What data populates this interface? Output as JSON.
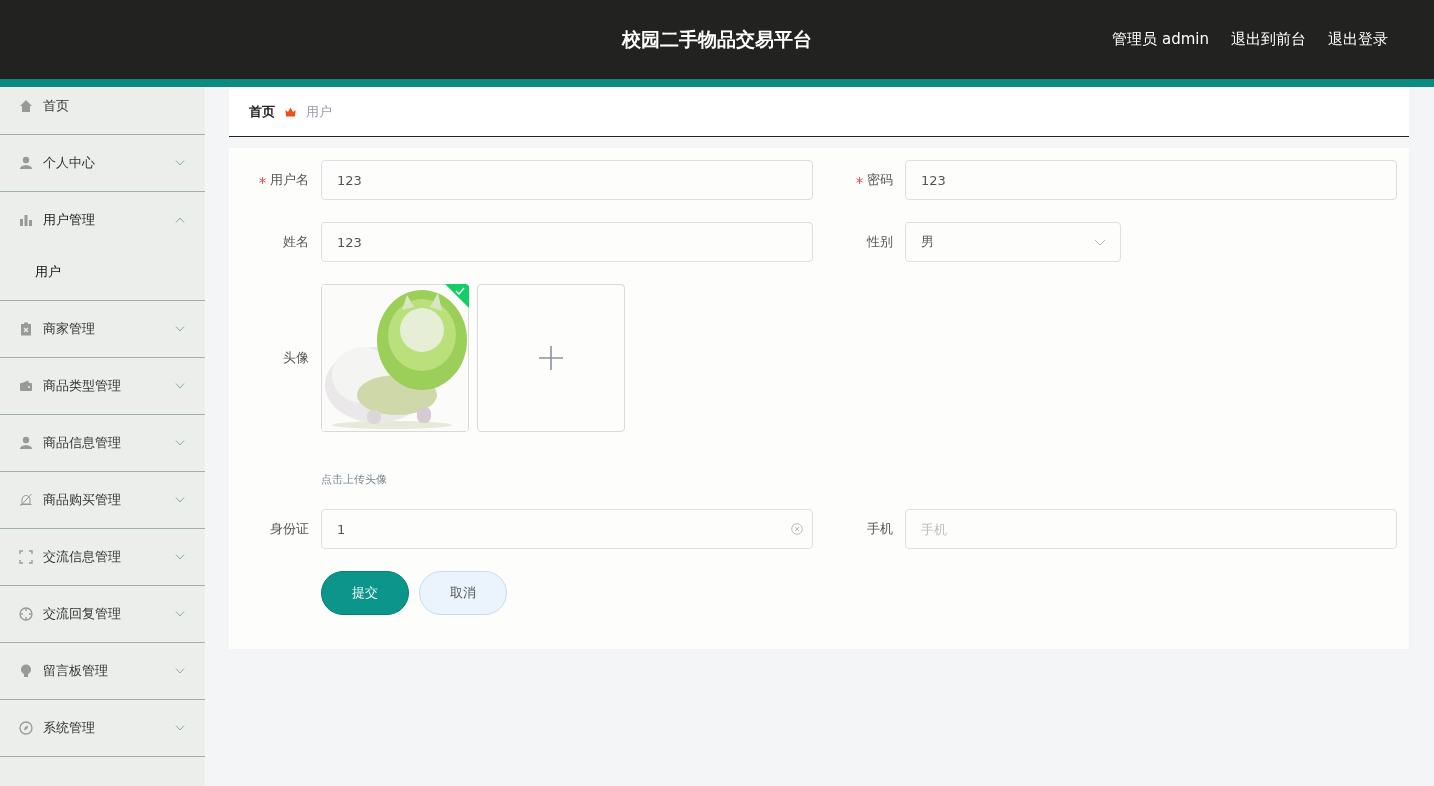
{
  "header": {
    "title": "校园二手物品交易平台",
    "user": "管理员 admin",
    "links": [
      "退出到前台",
      "退出登录"
    ]
  },
  "sidebar": {
    "items": [
      {
        "label": "首页",
        "kind": "link"
      },
      {
        "label": "个人中心",
        "kind": "menu",
        "expanded": false
      },
      {
        "label": "用户管理",
        "kind": "menu",
        "expanded": true,
        "children": [
          {
            "label": "用户"
          }
        ]
      },
      {
        "label": "商家管理",
        "kind": "menu",
        "expanded": false
      },
      {
        "label": "商品类型管理",
        "kind": "menu",
        "expanded": false
      },
      {
        "label": "商品信息管理",
        "kind": "menu",
        "expanded": false
      },
      {
        "label": "商品购买管理",
        "kind": "menu",
        "expanded": false
      },
      {
        "label": "交流信息管理",
        "kind": "menu",
        "expanded": false
      },
      {
        "label": "交流回复管理",
        "kind": "menu",
        "expanded": false
      },
      {
        "label": "留言板管理",
        "kind": "menu",
        "expanded": false
      },
      {
        "label": "系统管理",
        "kind": "menu",
        "expanded": false
      }
    ]
  },
  "breadcrumb": [
    "首页",
    "用户"
  ],
  "form": {
    "fields": [
      {
        "kind": "text",
        "label": "用户名",
        "required": true,
        "value": "123"
      },
      {
        "kind": "text",
        "label": "密码",
        "required": true,
        "value": "123"
      },
      {
        "kind": "text",
        "label": "姓名",
        "required": false,
        "value": "123"
      },
      {
        "kind": "select",
        "label": "性别",
        "required": false,
        "value": "男"
      },
      {
        "kind": "upload",
        "label": "头像",
        "required": false,
        "images": [
          {
            "kind": "picture",
            "uploaded": true
          }
        ],
        "hint": "点击上传头像"
      },
      {
        "kind": "text",
        "label": "身份证",
        "required": false,
        "value": "1",
        "clearable": true
      },
      {
        "kind": "text",
        "label": "手机",
        "required": false,
        "placeholder": "手机"
      }
    ],
    "buttons": [
      {
        "label": "提交",
        "kind": "primary"
      },
      {
        "label": "取消",
        "kind": "default"
      }
    ]
  }
}
